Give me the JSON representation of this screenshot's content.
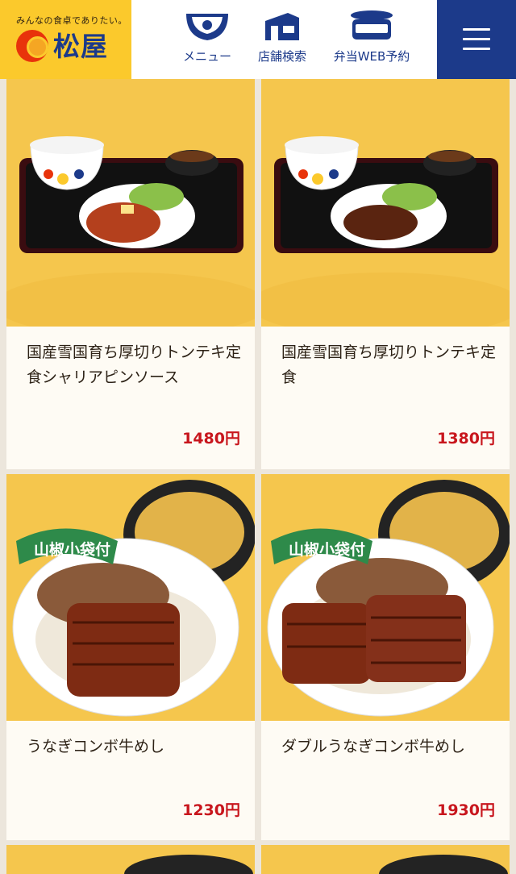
{
  "header": {
    "tagline": "みんなの食卓でありたい。",
    "brand": "松屋",
    "nav": [
      {
        "label": "メニュー",
        "icon": "bowl-icon"
      },
      {
        "label": "店舗検索",
        "icon": "store-icon"
      },
      {
        "label": "弁当WEB予約",
        "icon": "bento-box-icon"
      }
    ],
    "menu_icon": "hamburger-icon"
  },
  "colors": {
    "brand_blue": "#1c3a8a",
    "brand_yellow": "#fbc92c",
    "price_red": "#c8161d",
    "card_bg": "#fefbf4"
  },
  "menu_items": [
    {
      "name": "国産雪国育ち厚切りトンテキ定食シャリアピンソース",
      "price": "1480円"
    },
    {
      "name": "国産雪国育ち厚切りトンテキ定食",
      "price": "1380円"
    },
    {
      "name": "うなぎコンボ牛めし",
      "price": "1230円",
      "badge": "山椒小袋付"
    },
    {
      "name": "ダブルうなぎコンボ牛めし",
      "price": "1930円",
      "badge": "山椒小袋付"
    }
  ]
}
